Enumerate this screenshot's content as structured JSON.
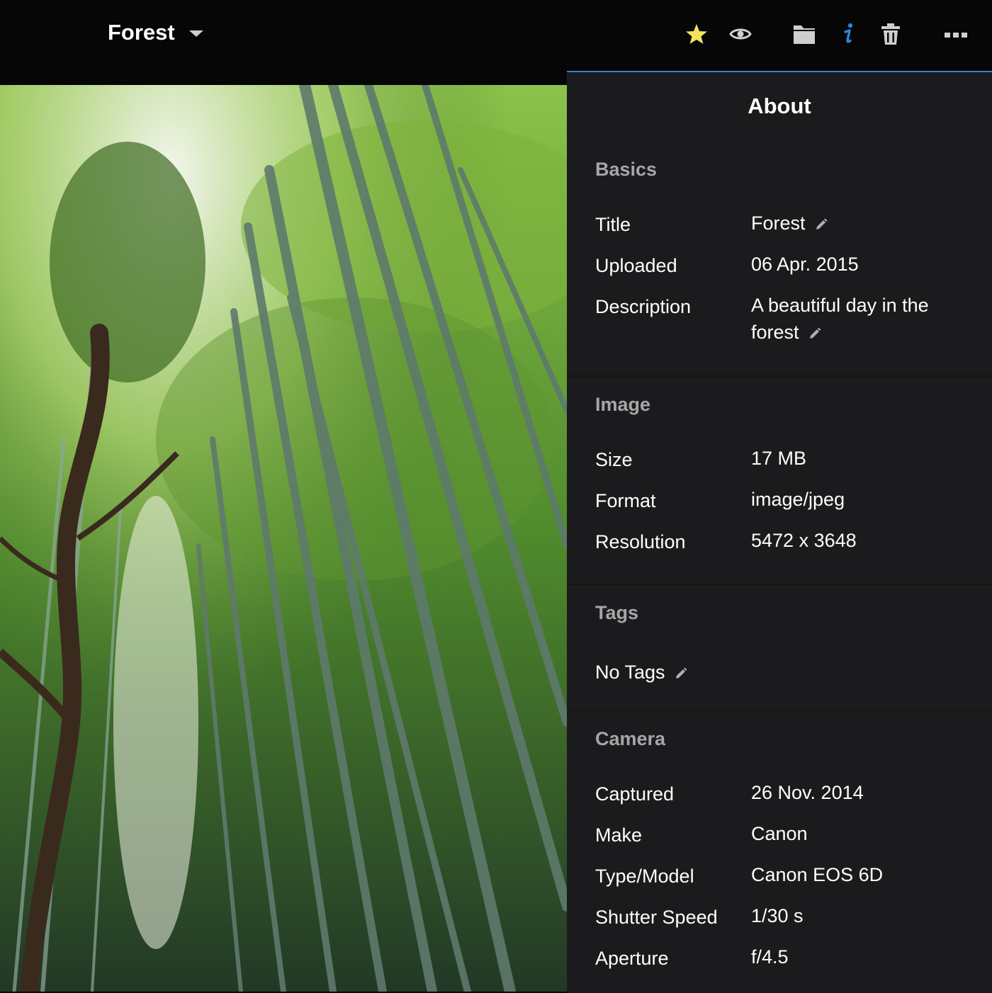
{
  "header": {
    "album_title": "Forest",
    "icons": [
      "star-icon",
      "eye-icon",
      "folder-icon",
      "info-icon",
      "trash-icon",
      "more-icon"
    ],
    "colors": {
      "star": "#f2e45a",
      "info": "#2f83d6",
      "icon": "#cfcfcf"
    }
  },
  "panel": {
    "title": "About",
    "basics": {
      "heading": "Basics",
      "title_label": "Title",
      "title_value": "Forest",
      "uploaded_label": "Uploaded",
      "uploaded_value": "06 Apr. 2015",
      "description_label": "Description",
      "description_value": "A beautiful day in the forest"
    },
    "image": {
      "heading": "Image",
      "size_label": "Size",
      "size_value": "17 MB",
      "format_label": "Format",
      "format_value": "image/jpeg",
      "resolution_label": "Resolution",
      "resolution_value": "5472 x 3648"
    },
    "tags": {
      "heading": "Tags",
      "value": "No Tags"
    },
    "camera": {
      "heading": "Camera",
      "captured_label": "Captured",
      "captured_value": "26 Nov. 2014",
      "make_label": "Make",
      "make_value": "Canon",
      "model_label": "Type/Model",
      "model_value": "Canon EOS 6D",
      "shutter_label": "Shutter Speed",
      "shutter_value": "1/30 s",
      "aperture_label": "Aperture",
      "aperture_value": "f/4.5"
    }
  }
}
